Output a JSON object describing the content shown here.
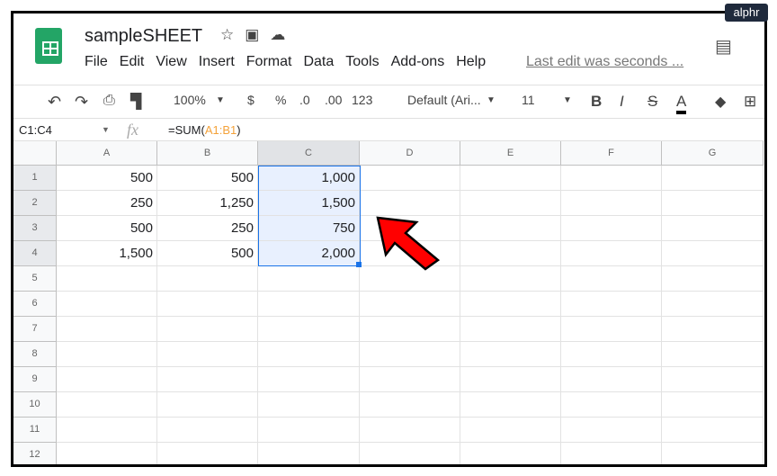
{
  "watermark": "alphr",
  "doc": {
    "title": "sampleSHEET",
    "last_edit": "Last edit was seconds ..."
  },
  "menu": [
    "File",
    "Edit",
    "View",
    "Insert",
    "Format",
    "Data",
    "Tools",
    "Add-ons",
    "Help"
  ],
  "toolbar": {
    "zoom": "100%",
    "currency": "$",
    "percent": "%",
    "dec_less": ".0",
    "dec_more": ".00",
    "format": "123",
    "font": "Default (Ari...",
    "size": "11",
    "bold": "B",
    "italic": "I",
    "strike": "S",
    "color": "A"
  },
  "formula_bar": {
    "name_box": "C1:C4",
    "fx": "fx",
    "formula_prefix": "=SUM(",
    "formula_ref": "A1:B1",
    "formula_suffix": ")"
  },
  "columns": [
    "A",
    "B",
    "C",
    "D",
    "E",
    "F",
    "G"
  ],
  "rows": [
    [
      "500",
      "500",
      "1,000"
    ],
    [
      "250",
      "1,250",
      "1,500"
    ],
    [
      "500",
      "250",
      "750"
    ],
    [
      "1,500",
      "500",
      "2,000"
    ]
  ],
  "row_count": 12,
  "colors": {
    "selection": "#e8f0fe",
    "selection_border": "#1a73e8",
    "arrow": "#ff0000",
    "ref": "#f4a23a"
  }
}
